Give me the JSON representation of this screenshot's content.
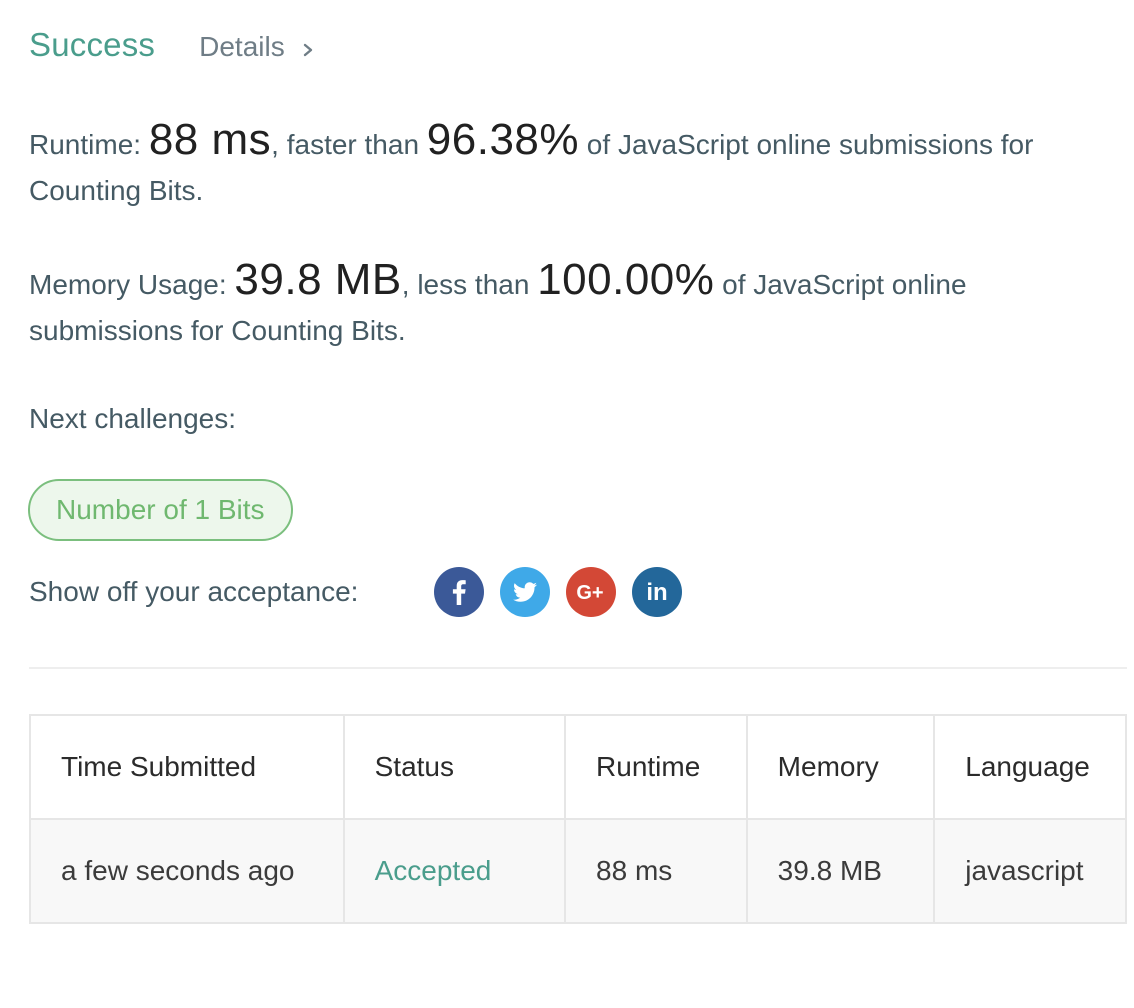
{
  "header": {
    "status": "Success",
    "details_label": "Details"
  },
  "runtime_stat": {
    "label": "Runtime: ",
    "value": "88 ms",
    "connector": ", faster than ",
    "percent": "96.38%",
    "suffix": " of JavaScript online submissions for Counting Bits."
  },
  "memory_stat": {
    "label": "Memory Usage: ",
    "value": "39.8 MB",
    "connector": ", less than ",
    "percent": "100.00%",
    "suffix": " of JavaScript online submissions for Counting Bits."
  },
  "next_challenges": {
    "label": "Next challenges:",
    "items": [
      "Number of 1 Bits"
    ]
  },
  "share": {
    "label": "Show off your acceptance:",
    "icons": [
      "facebook-icon",
      "twitter-icon",
      "google-plus-icon",
      "linkedin-icon"
    ]
  },
  "submissions": {
    "columns": [
      "Time Submitted",
      "Status",
      "Runtime",
      "Memory",
      "Language"
    ],
    "rows": [
      {
        "time": "a few seconds ago",
        "status": "Accepted",
        "runtime": "88 ms",
        "memory": "39.8 MB",
        "language": "javascript"
      }
    ]
  },
  "colors": {
    "success": "#4a9d8c",
    "pill_border": "#7bbf7e",
    "pill_bg": "#edf7ec",
    "facebook": "#3b5998",
    "twitter": "#3fa9e8",
    "google_plus": "#d34836",
    "linkedin": "#23679a"
  }
}
